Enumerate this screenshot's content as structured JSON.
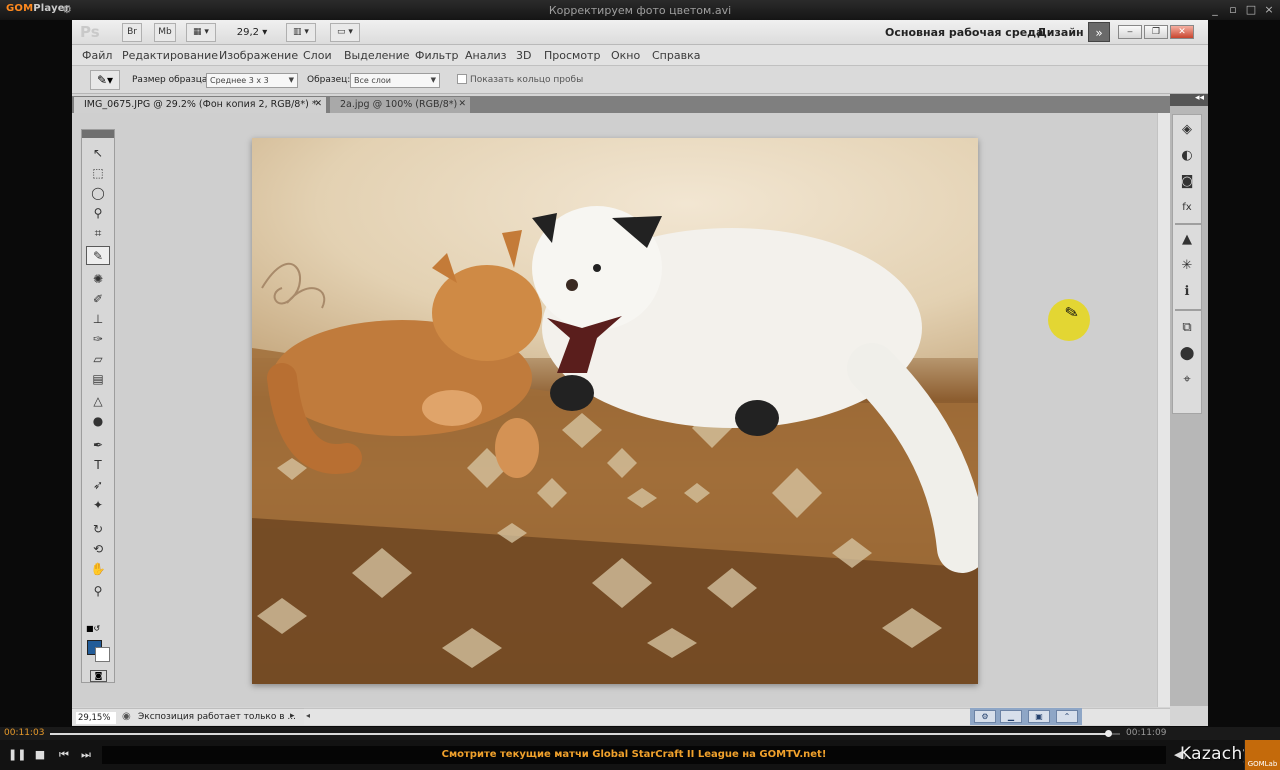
{
  "player": {
    "logo_left": "GOM",
    "logo_right": "Player",
    "window_title": "Корректируем фото цветом.avi",
    "controls": {
      "minimize": "_",
      "restore": "▫",
      "maximize": "□",
      "close": "×"
    },
    "time_current": "00:11:03",
    "time_total": "00:11:09",
    "ticker": "Смотрите текущие матчи Global StarCraft II League на GOMTV.net!",
    "watermark": "Kazachya.net",
    "gomlab": "GOMLab",
    "progress_fraction": 0.99
  },
  "photoshop": {
    "logo": "Ps",
    "appbar_buttons": [
      "Br",
      "Mb"
    ],
    "zoom": "29,2",
    "workspace": "Основная рабочая среда",
    "design": "Дизайн",
    "more": "»",
    "menu": [
      "Файл",
      "Редактирование",
      "Изображение",
      "Слои",
      "Выделение",
      "Фильтр",
      "Анализ",
      "3D",
      "Просмотр",
      "Окно",
      "Справка"
    ],
    "options": {
      "sample_size_label": "Размер образца:",
      "sample_size_value": "Среднее 3 x 3",
      "sample_label": "Образец:",
      "sample_value": "Все слои",
      "ring_label": "Показать кольцо пробы"
    },
    "tabs": [
      {
        "label": "IMG_0675.JPG @ 29.2% (Фон копия 2, RGB/8*) *"
      },
      {
        "label": "2a.jpg @ 100% (RGB/8*)"
      }
    ],
    "status": {
      "zoom": "29,15%",
      "message": "Экспозиция работает только в ..."
    },
    "tools": [
      "move-tool",
      "marquee-tool",
      "lasso-tool",
      "quick-selection-tool",
      "crop-tool",
      "eyedropper-tool",
      "healing-brush-tool",
      "brush-tool",
      "clone-stamp-tool",
      "history-brush-tool",
      "eraser-tool",
      "gradient-tool",
      "blur-tool",
      "dodge-tool",
      "pen-tool",
      "type-tool",
      "path-selection-tool",
      "shape-tool",
      "3d-rotate-tool",
      "3d-orbit-tool",
      "hand-tool",
      "zoom-tool"
    ],
    "dock_icons": [
      "layers-icon",
      "adjustments-icon",
      "masks-icon",
      "fx-icon",
      "histogram-icon",
      "navigator-icon",
      "info-icon",
      "swatches-icon",
      "3d-icon",
      "transform-icon"
    ],
    "colors": {
      "foreground": "#225c98",
      "background": "#ffffff"
    }
  }
}
